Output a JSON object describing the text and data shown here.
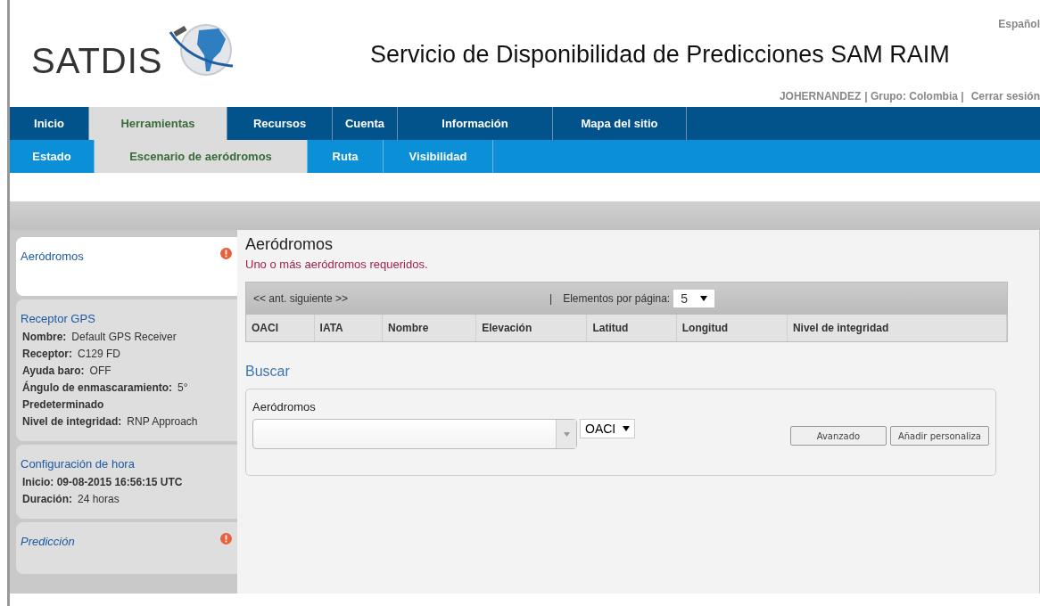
{
  "header": {
    "logo": "SATDIS",
    "title": "Servicio de Disponibilidad de Predicciones SAM RAIM",
    "language": "Español",
    "user": "JOHERNANDEZ",
    "group": "| Grupo: Colombia |",
    "logout": "Cerrar sesión"
  },
  "nav": [
    {
      "label": "Inicio",
      "selected": false
    },
    {
      "label": "Herramientas",
      "selected": true
    },
    {
      "label": "Recursos",
      "selected": false
    },
    {
      "label": "Cuenta",
      "selected": false
    },
    {
      "label": "Información",
      "selected": false
    },
    {
      "label": "Mapa del sitio",
      "selected": false
    }
  ],
  "subnav": [
    {
      "label": "Estado",
      "selected": false
    },
    {
      "label": "Escenario de aeródromos",
      "selected": true
    },
    {
      "label": "Ruta",
      "selected": false
    },
    {
      "label": "Visibilidad",
      "selected": false
    }
  ],
  "sidebar": [
    {
      "title": "Aeródromos",
      "selected": true,
      "alert": true,
      "italic": false
    },
    {
      "title": "Receptor GPS",
      "selected": false,
      "alert": false,
      "italic": false,
      "details": [
        {
          "label": "Nombre:",
          "value": "Default GPS Receiver"
        },
        {
          "label": "Receptor:",
          "value": "C129  FD"
        },
        {
          "label": "Ayuda baro:",
          "value": "OFF"
        },
        {
          "label": "Ángulo de enmascaramiento:",
          "value": "5°"
        },
        {
          "label": "Predeterminado"
        },
        {
          "label": "Nivel de integridad:",
          "value": "RNP Approach"
        }
      ]
    },
    {
      "title": "Configuración de hora",
      "selected": false,
      "alert": false,
      "italic": false,
      "details": [
        {
          "label": "Inicio: 09-08-2015 16:56:15 UTC"
        },
        {
          "label": "Duración:",
          "value": "24 horas"
        }
      ]
    },
    {
      "title": "Predicción",
      "selected": false,
      "alert": true,
      "italic": true
    }
  ],
  "main": {
    "heading": "Aeródromos",
    "error": "Uno o más aeródromos requeridos.",
    "pager": {
      "links": "<< ant. siguiente >>",
      "separator": "|",
      "per_page_label": "Elementos por página:",
      "per_page": "5"
    },
    "columns": [
      "OACI",
      "IATA",
      "Nombre",
      "Elevación",
      "Latitud",
      "Longitud",
      "Nivel de integridad"
    ],
    "search": {
      "title": "Buscar",
      "field_label": "Aeródromos",
      "code_type": "OACI",
      "buttons": [
        "Avanzado",
        "Añadir personaliza"
      ]
    }
  }
}
